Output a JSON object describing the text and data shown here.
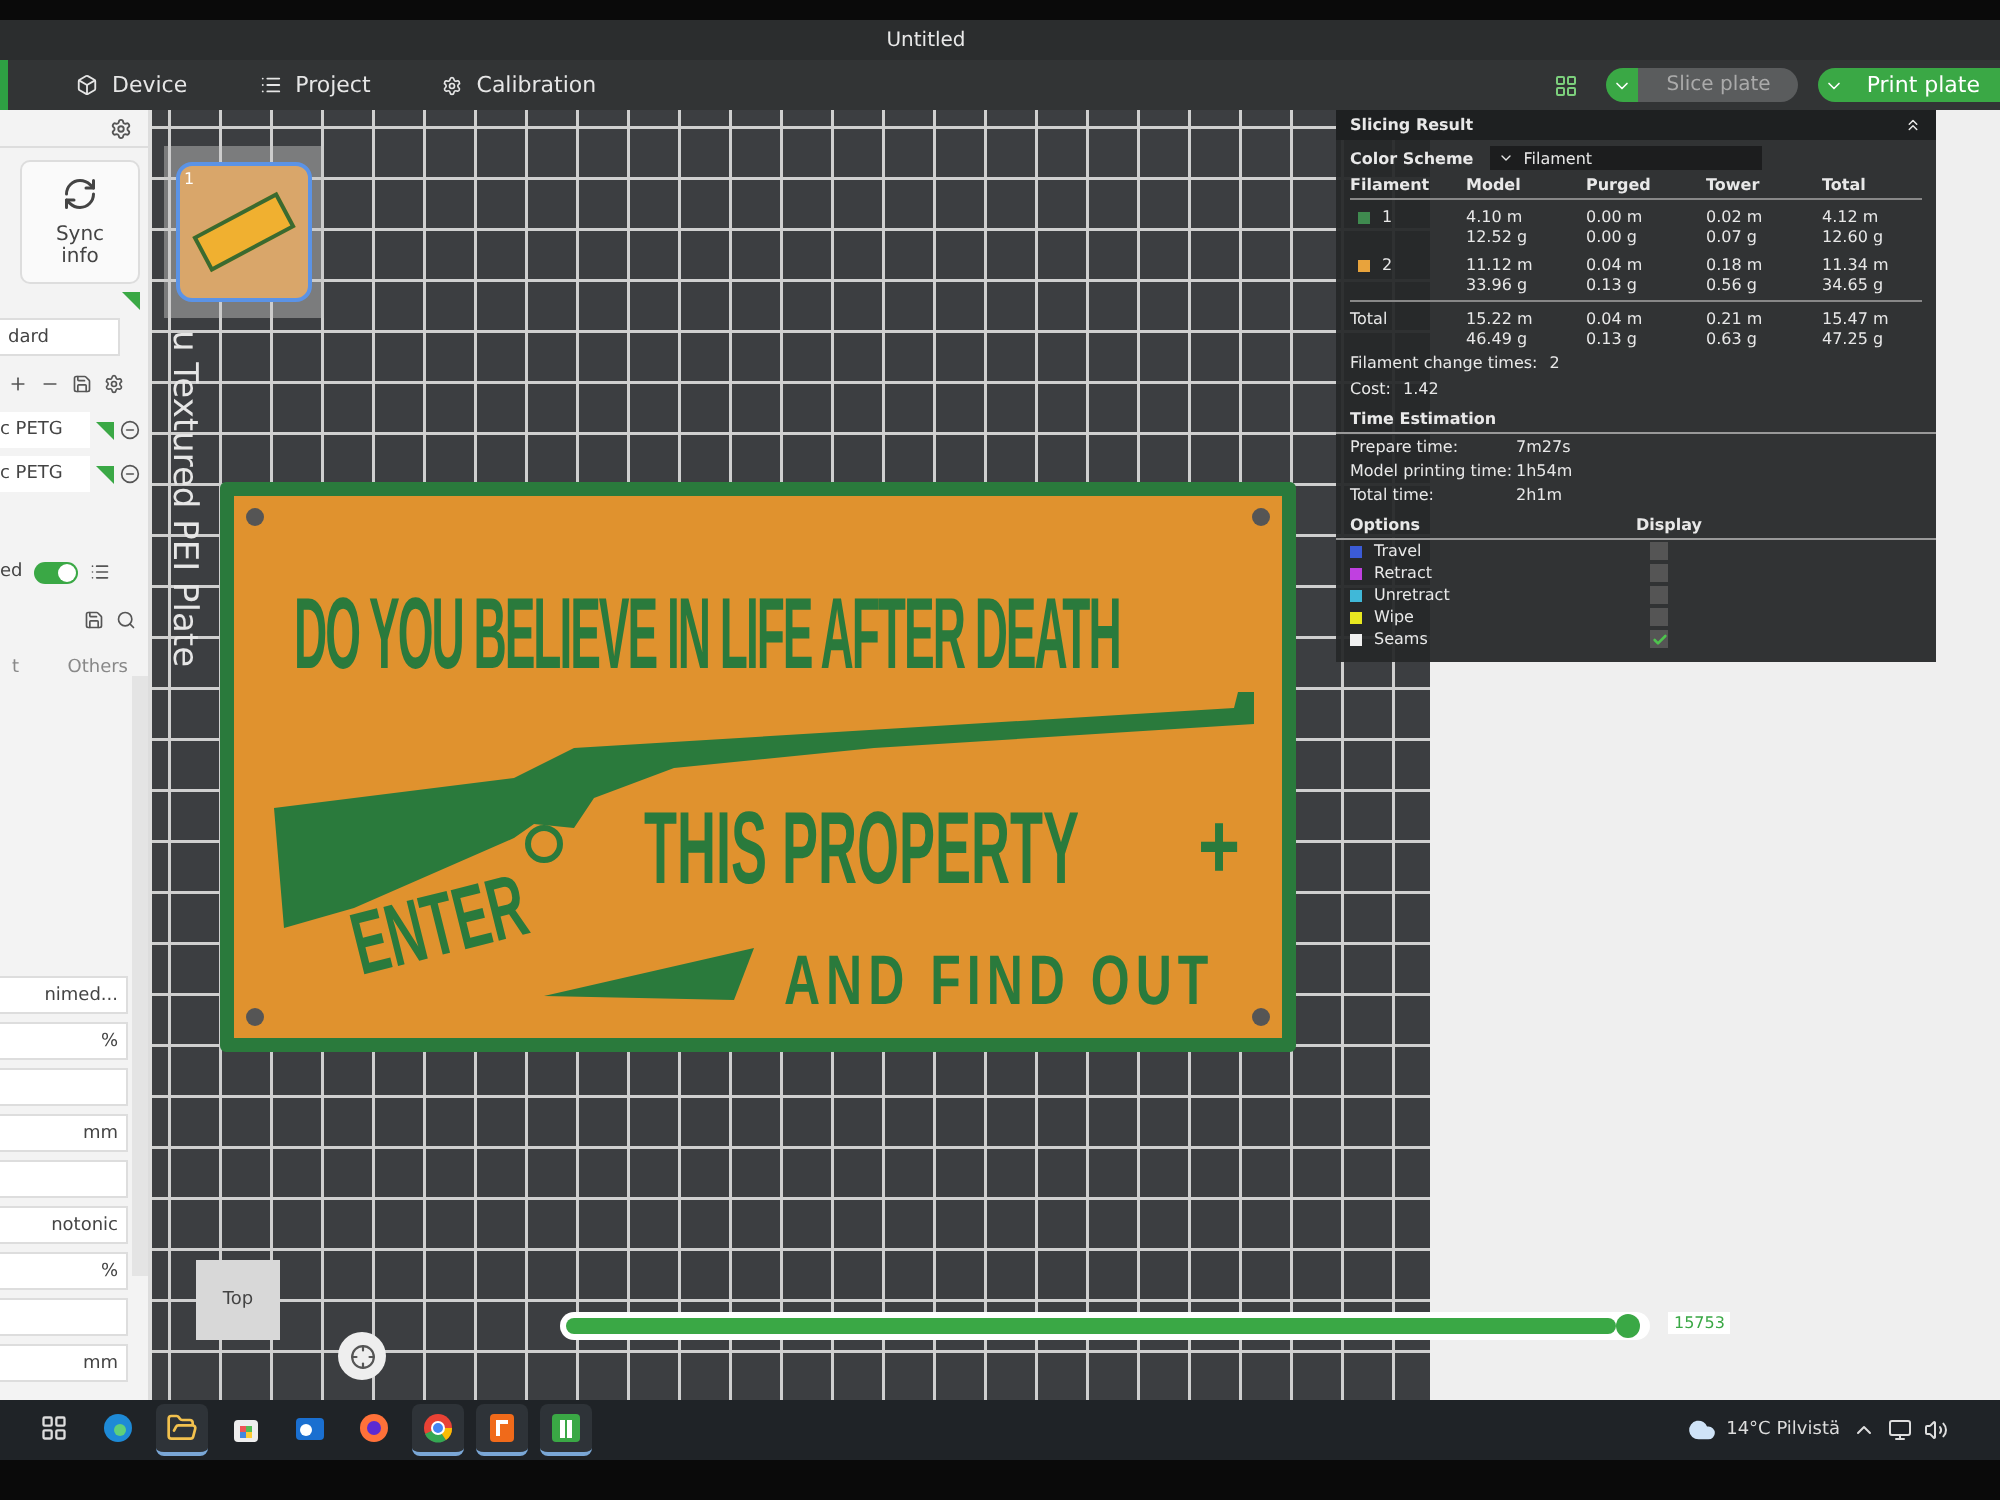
{
  "window": {
    "title": "Untitled"
  },
  "menu_tabs": [
    {
      "label": "Device",
      "selected": false
    },
    {
      "label": "Project",
      "selected": false
    },
    {
      "label": "Calibration",
      "selected": false
    }
  ],
  "toolbar": {
    "slice_button": "Slice plate",
    "print_button": "Print plate"
  },
  "sidebar": {
    "sync_label": "Sync info",
    "plate_field": "dard",
    "filaments": [
      {
        "label": "c PETG"
      },
      {
        "label": "c PETG"
      }
    ],
    "toggle": {
      "label": "ed",
      "on": true
    },
    "tabs": [
      {
        "label": "t",
        "selected": false
      },
      {
        "label": "Others",
        "selected": false
      }
    ],
    "fields": [
      {
        "kind": "select",
        "value": "nimed..."
      },
      {
        "kind": "number",
        "unit": "%"
      },
      {
        "kind": "blank"
      },
      {
        "kind": "number",
        "unit": "mm"
      },
      {
        "kind": "blank"
      },
      {
        "kind": "select",
        "value": "notonic"
      },
      {
        "kind": "number",
        "unit": "%"
      },
      {
        "kind": "blank"
      },
      {
        "kind": "number",
        "unit": "mm"
      }
    ]
  },
  "viewport": {
    "plate_name": "u Textured PEI Plate",
    "plate_number": "1",
    "sign_lines": [
      {
        "kind": "headline",
        "text": "DO YOU BELIEVE IN LIFE AFTER DEATH"
      },
      {
        "kind": "tilted",
        "text": "ENTER"
      },
      {
        "kind": "middle",
        "text": "THIS PROPERTY"
      },
      {
        "kind": "plus",
        "text": "+"
      },
      {
        "kind": "bottom",
        "text": "AND FIND OUT"
      }
    ],
    "view_label": "Top",
    "layer_slider": {
      "level": 1,
      "reading": "15753"
    }
  },
  "slicing_result": {
    "title": "Slicing Result",
    "color_scheme_label": "Color Scheme",
    "color_scheme_value": "Filament",
    "columns": [
      "Filament",
      "Model",
      "Purged",
      "Tower",
      "Total"
    ],
    "rows": [
      {
        "color": "#3f8a4f",
        "cells": [
          [
            "1"
          ],
          [
            "4.10 m",
            "12.52 g"
          ],
          [
            "0.00 m",
            "0.00 g"
          ],
          [
            "0.02 m",
            "0.07 g"
          ],
          [
            "4.12 m",
            "12.60 g"
          ]
        ]
      },
      {
        "color": "#e8a33c",
        "cells": [
          [
            "2"
          ],
          [
            "11.12 m",
            "33.96 g"
          ],
          [
            "0.04 m",
            "0.13 g"
          ],
          [
            "0.18 m",
            "0.56 g"
          ],
          [
            "11.34 m",
            "34.65 g"
          ]
        ]
      }
    ],
    "total": {
      "cells": [
        [
          "Total"
        ],
        [
          "15.22 m",
          "46.49 g"
        ],
        [
          "0.04 m",
          "0.13 g"
        ],
        [
          "0.21 m",
          "0.63 g"
        ],
        [
          "15.47 m",
          "47.25 g"
        ]
      ]
    },
    "change_times": {
      "label": "Filament change times:",
      "value": "2"
    },
    "cost": {
      "label": "Cost:",
      "value": "1.42"
    },
    "time_title": "Time Estimation",
    "times": [
      {
        "label": "Prepare time:",
        "value": "7m27s"
      },
      {
        "label": "Model printing time:",
        "value": "1h54m"
      },
      {
        "label": "Total time:",
        "value": "2h1m"
      }
    ],
    "options_header": "Options",
    "display_header": "Display",
    "options": [
      {
        "label": "Travel",
        "color": "#3b5bd6",
        "checked": false
      },
      {
        "label": "Retract",
        "color": "#c040e0",
        "checked": false
      },
      {
        "label": "Unretract",
        "color": "#40b8d8",
        "checked": false
      },
      {
        "label": "Wipe",
        "color": "#e8e820",
        "checked": false
      },
      {
        "label": "Seams",
        "color": "#f0f0f0",
        "checked": true
      }
    ]
  },
  "taskbar": {
    "apps": [
      {
        "kind": "taskview",
        "active": false
      },
      {
        "kind": "edge",
        "active": false
      },
      {
        "kind": "explorer",
        "active": true
      },
      {
        "kind": "store",
        "active": false
      },
      {
        "kind": "mail",
        "active": false
      },
      {
        "kind": "firefox",
        "active": false
      },
      {
        "kind": "chrome",
        "active": true
      },
      {
        "kind": "fapp",
        "active": true
      },
      {
        "kind": "slicer",
        "active": true
      }
    ],
    "weather": "14°C Pilvistä"
  }
}
